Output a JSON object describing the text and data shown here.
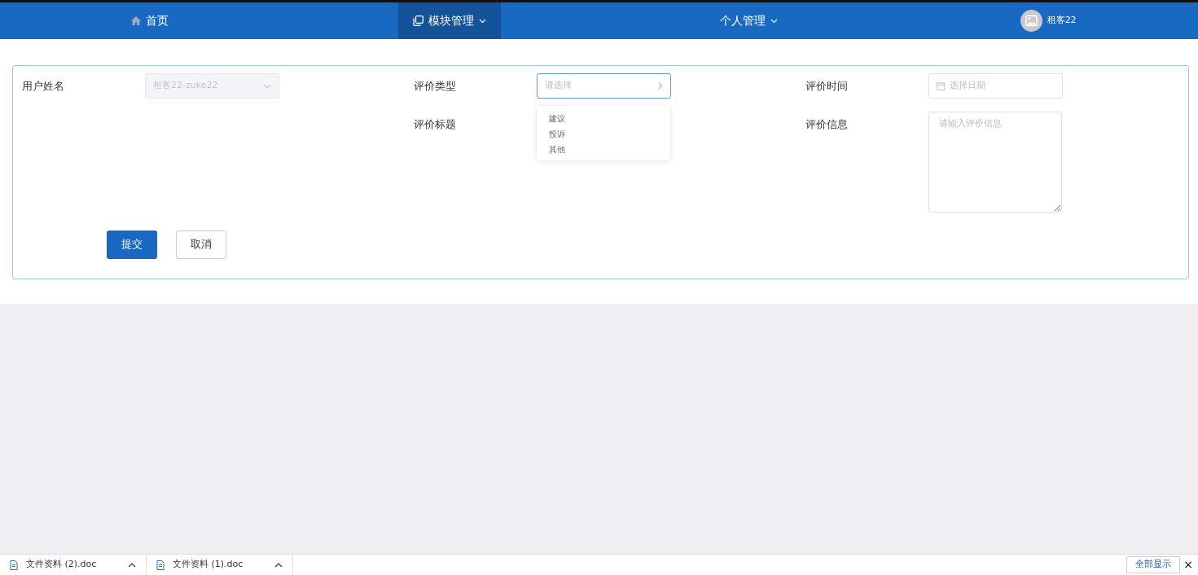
{
  "navbar": {
    "items": [
      {
        "label": "首页",
        "selected": false,
        "dropdown": false
      },
      {
        "label": "模块管理",
        "selected": true,
        "dropdown": true
      },
      {
        "label": "个人管理",
        "selected": false,
        "dropdown": true
      }
    ],
    "user": {
      "name": "租客22"
    }
  },
  "form": {
    "fields": [
      {
        "label": "用户姓名",
        "kind": "select",
        "value": "租客22-zuke22",
        "disabled": true,
        "open": false
      },
      {
        "label": "评价类型",
        "kind": "select",
        "placeholder": "请选择",
        "open": true,
        "options": [
          "建议",
          "投诉",
          "其他"
        ]
      },
      {
        "label": "评价时间",
        "kind": "date",
        "placeholder": "选择日期"
      },
      {
        "label": "评价标题",
        "kind": "input"
      },
      {
        "label": "评价信息",
        "kind": "textarea",
        "placeholder": "请输入评价信息"
      }
    ],
    "buttons": [
      {
        "label": "提交",
        "primary": true
      },
      {
        "label": "取消",
        "primary": false
      }
    ]
  },
  "downloads": {
    "items": [
      {
        "name": "文件资料 (2).doc"
      },
      {
        "name": "文件资料 (1).doc"
      }
    ],
    "show_all": "全部显示",
    "close": "×"
  }
}
